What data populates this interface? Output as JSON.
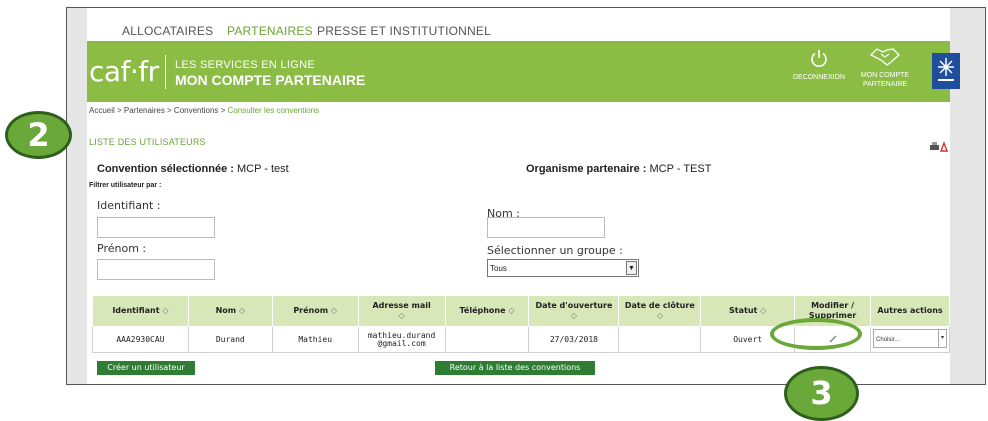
{
  "topnav": {
    "items": [
      {
        "label": "ALLOCATAIRES",
        "active": false
      },
      {
        "label": "PARTENAIRES",
        "active": true
      },
      {
        "label": "PRESSE ET INSTITUTIONNEL",
        "active": false
      }
    ]
  },
  "header": {
    "logo": "caf·fr",
    "services_line1": "LES SERVICES EN LIGNE",
    "services_line2": "MON COMPTE PARTENAIRE",
    "logout_label": "DECONNEXION",
    "account_label_line1": "MON COMPTE",
    "account_label_line2": "PARTENAIRE",
    "brand_color": "#8bbd45"
  },
  "breadcrumb": {
    "trail": "Accueil > Partenaires > Conventions > ",
    "current": "Consulter les conventions"
  },
  "page_title": "LISTE DES UTILISATEURS",
  "convention": {
    "label": "Convention sélectionnée :",
    "value": "MCP - test"
  },
  "organisme": {
    "label": "Organisme partenaire :",
    "value": "MCP - TEST"
  },
  "filters": {
    "heading": "Filtrer utilisateur par :",
    "identifiant_label": "Identifiant :",
    "identifiant_value": "",
    "nom_label": "Nom :",
    "nom_value": "",
    "prenom_label": "Prénom :",
    "prenom_value": "",
    "groupe_label": "Sélectionner un groupe :",
    "groupe_value": "Tous"
  },
  "table": {
    "headers": [
      "Identifiant",
      "Nom",
      "Prénom",
      "Adresse mail",
      "Téléphone",
      "Date d'ouverture",
      "Date de clôture",
      "Statut",
      "Modifier / Supprimer",
      "Autres actions"
    ],
    "rows": [
      {
        "identifiant": "AAA2930CAU",
        "nom": "Durand",
        "prenom": "Mathieu",
        "email_line1": "mathieu.durand",
        "email_line2": "@gmail.com",
        "telephone": "",
        "date_ouverture": "27/03/2018",
        "date_cloture": "",
        "statut": "Ouvert",
        "edit_icon": "pencil-icon",
        "action_value": "Choisir..."
      }
    ]
  },
  "buttons": {
    "create_user": "Créer un utilisateur",
    "back_to_list": "Retour à la liste des conventions"
  },
  "annotations": {
    "badge_left": "2",
    "badge_bottom": "3",
    "highlight_color": "#6aa83a"
  }
}
